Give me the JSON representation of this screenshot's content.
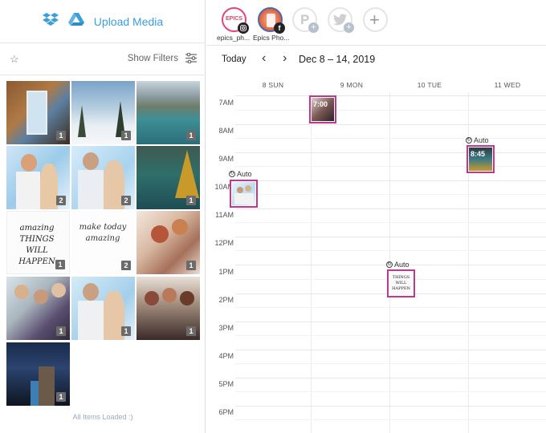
{
  "upload": {
    "label": "Upload Media"
  },
  "filters": {
    "show_label": "Show Filters"
  },
  "media": [
    {
      "count": "1"
    },
    {
      "count": "1"
    },
    {
      "count": "1"
    },
    {
      "count": "2"
    },
    {
      "count": "2"
    },
    {
      "count": "1"
    },
    {
      "count": "1",
      "text": "amazing THINGS WILL HAPPEN"
    },
    {
      "count": "2",
      "text": "make today amazing"
    },
    {
      "count": "1"
    },
    {
      "count": "1"
    },
    {
      "count": "1"
    },
    {
      "count": "1"
    },
    {
      "count": "1"
    }
  ],
  "status": {
    "loaded": "All Items Loaded :)"
  },
  "accounts": [
    {
      "name": "epics_ph...",
      "network": "instagram-icon",
      "avatar_text": "EPICS"
    },
    {
      "name": "Epics Pho...",
      "network": "facebook-icon",
      "badge": "f"
    },
    {
      "network": "pinterest-icon",
      "icon": "P"
    },
    {
      "network": "twitter-icon"
    }
  ],
  "calendar": {
    "today": "Today",
    "prev": "‹",
    "next": "›",
    "range": "Dec 8 – 14, 2019",
    "days": [
      "8 SUN",
      "9 MON",
      "10 TUE",
      "11 WED"
    ],
    "hours": [
      "7AM",
      "8AM",
      "9AM",
      "10AM",
      "11AM",
      "12PM",
      "1PM",
      "2PM",
      "3PM",
      "4PM",
      "5PM",
      "6PM"
    ],
    "auto_label": "Auto",
    "posts": [
      {
        "overlay": "7:00"
      },
      {
        "overlay": "8:45"
      },
      {},
      {
        "text": "THINGS WILL HAPPEN"
      }
    ]
  },
  "colors": {
    "accent": "#3b9fd8",
    "post_border": "#c2378e",
    "badge": "#6b6b6b"
  }
}
